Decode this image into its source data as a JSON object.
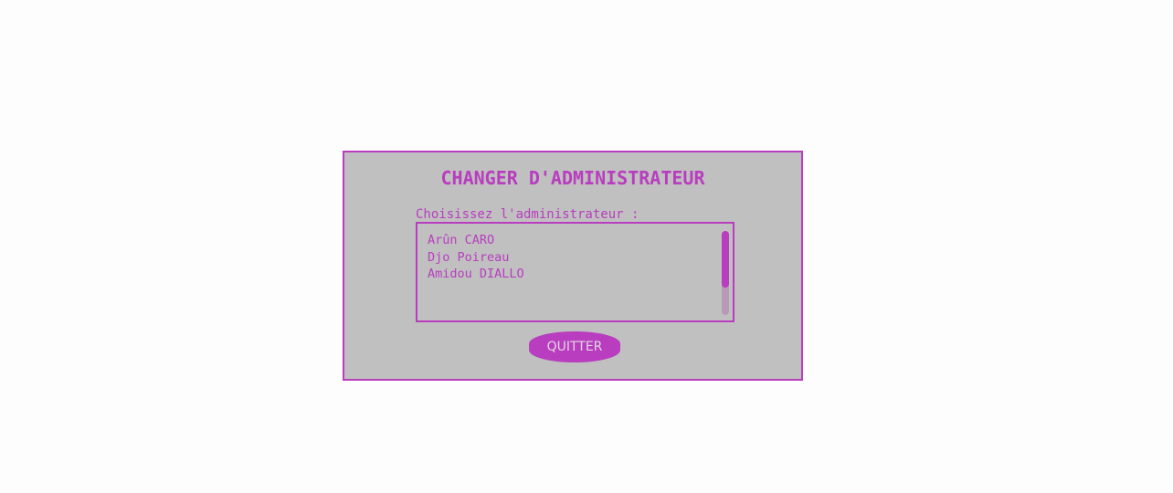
{
  "dialog": {
    "title": "CHANGER D'ADMINISTRATEUR",
    "prompt": "Choisissez l'administrateur :",
    "admins": [
      "Arûn CARO",
      "Djo Poireau",
      "Amidou DIALLO"
    ],
    "quit_label": "QUITTER"
  },
  "colors": {
    "accent": "#b83dbf",
    "panel_bg": "#c0c0c0",
    "page_bg": "#fdfdfd",
    "button_text": "#e3d5e3"
  }
}
